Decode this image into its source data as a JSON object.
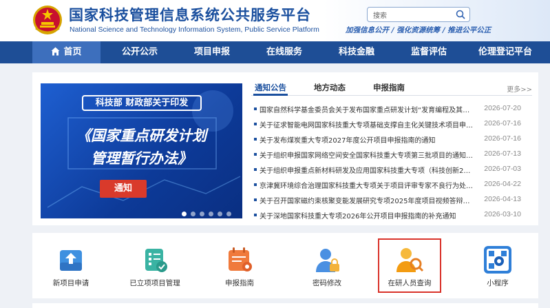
{
  "header": {
    "title": "国家科技管理信息系统公共服务平台",
    "subtitle": "National Science and Technology Information System, Public Service Platform",
    "search_placeholder": "搜索",
    "slogan": "加强信息公开 / 强化资源统筹 / 推进公平公正"
  },
  "nav": {
    "items": [
      {
        "label": "首页",
        "icon": "home-icon",
        "active": true
      },
      {
        "label": "公开公示"
      },
      {
        "label": "项目申报"
      },
      {
        "label": "在线服务"
      },
      {
        "label": "科技金融"
      },
      {
        "label": "监督评估"
      },
      {
        "label": "伦理登记平台"
      }
    ]
  },
  "banner": {
    "top_text": "科技部 财政部关于印发",
    "line1": "《国家重点研发计划",
    "line2": "管理暂行办法》",
    "tag": "通知",
    "slide_count": 6,
    "active_slide": 1
  },
  "news": {
    "tabs": [
      "通知公告",
      "地方动态",
      "申报指南"
    ],
    "active_tab": 0,
    "more": "更多>>",
    "items": [
      {
        "title": "国家自然科学基金委员会关于发布国家重点研发计划“发育编程及其代谢...",
        "date": "2026-07-20"
      },
      {
        "title": "关于征求智能电网国家科技重大专项基础支撑自主化关键技术项目申报...",
        "date": "2026-07-16"
      },
      {
        "title": "关于发布煤炭重大专项2027年度公开项目申报指南的通知",
        "date": "2026-07-16"
      },
      {
        "title": "关于组织申报国家网络空间安全国家科技重大专项第三批项目的通知（...",
        "date": "2026-07-13"
      },
      {
        "title": "关于组织申报重点新材料研发及应用国家科技重大专项（科技创新2030...",
        "date": "2026-07-03"
      },
      {
        "title": "京津冀环境综合治理国家科技重大专项关于项目评审专家不良行为处理...",
        "date": "2026-04-22"
      },
      {
        "title": "关于召开国家磁约束核聚变能发展研究专项2025年度项目视频答辩评审...",
        "date": "2026-04-13"
      },
      {
        "title": "关于深地国家科技重大专项2026年公开项目申报指南的补充通知",
        "date": "2026-03-10"
      }
    ]
  },
  "quick_links": [
    {
      "label": "新项目申请",
      "icon": "upload-tray-icon"
    },
    {
      "label": "已立项项目管理",
      "icon": "checklist-icon"
    },
    {
      "label": "申报指南",
      "icon": "calendar-icon"
    },
    {
      "label": "密码修改",
      "icon": "user-lock-icon"
    },
    {
      "label": "在研人员查询",
      "icon": "user-search-icon",
      "highlighted": true
    },
    {
      "label": "小程序",
      "icon": "qr-code-icon"
    }
  ],
  "colors": {
    "brand_blue": "#1a4f9e",
    "nav_bg": "#1e4e96",
    "nav_active": "#3d6fbd",
    "highlight_red": "#d9322a"
  }
}
